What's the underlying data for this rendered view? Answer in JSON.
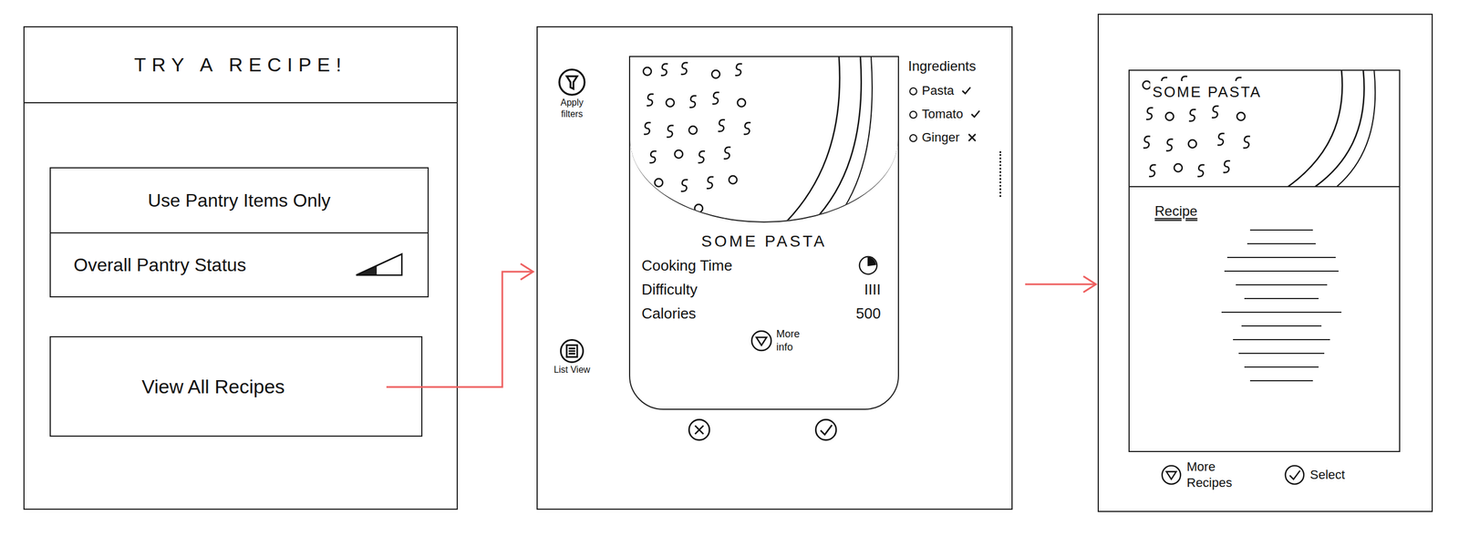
{
  "home": {
    "title": "TRY A RECIPE!",
    "options": [
      {
        "label": "Use Pantry Items Only",
        "kind": "plain"
      },
      {
        "label": "Overall Pantry Status",
        "kind": "meter",
        "level": 0.45
      }
    ],
    "view_all": "View All Recipes"
  },
  "recipe_card": {
    "filter_label": "Apply filters",
    "list_view_label": "List View",
    "name": "SOME PASTA",
    "stats": [
      {
        "label": "Cooking Time",
        "kind": "clock"
      },
      {
        "label": "Difficulty",
        "kind": "text",
        "value": "IIII"
      },
      {
        "label": "Calories",
        "kind": "text",
        "value": "500"
      }
    ],
    "more_info_label": "More info",
    "ingredients_title": "Ingredients",
    "ingredients": [
      {
        "name": "Pasta",
        "available": true
      },
      {
        "name": "Tomato",
        "available": true
      },
      {
        "name": "Ginger",
        "available": false
      }
    ]
  },
  "recipe_detail": {
    "name": "SOME PASTA",
    "section": "Recipe",
    "buttons": [
      {
        "label": "More Recipes",
        "kind": "more"
      },
      {
        "label": "Select",
        "kind": "select"
      }
    ]
  }
}
